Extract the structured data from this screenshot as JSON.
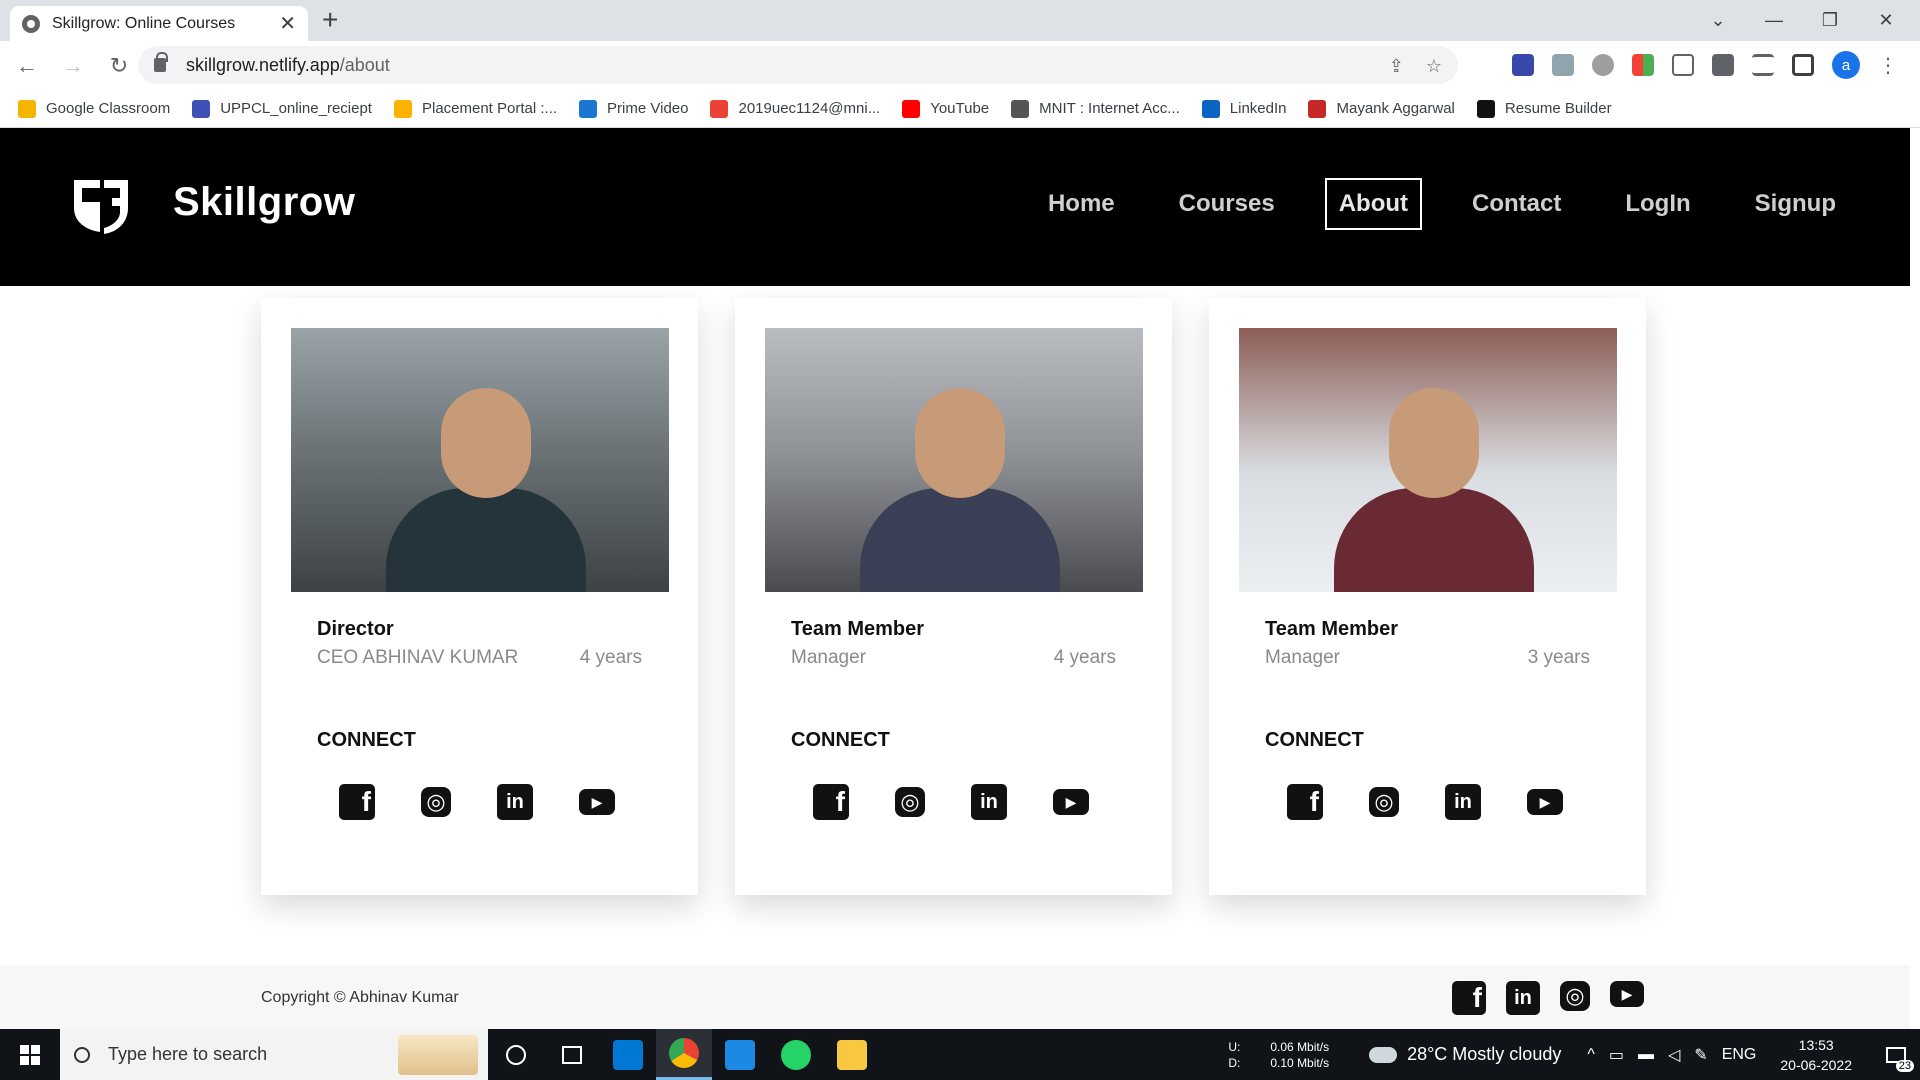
{
  "browser": {
    "tab_title": "Skillgrow: Online Courses",
    "url_host": "skillgrow.netlify.app",
    "url_path": "/about",
    "profile_initial": "a"
  },
  "bookmarks": [
    {
      "label": "Google Classroom",
      "color": "#f4b400"
    },
    {
      "label": "UPPCL_online_reciept",
      "color": "#3f51b5"
    },
    {
      "label": "Placement Portal :...",
      "color": "#ffb300"
    },
    {
      "label": "Prime Video",
      "color": "#1976d2"
    },
    {
      "label": "2019uec1124@mni...",
      "color": "#ea4335"
    },
    {
      "label": "YouTube",
      "color": "#ff0000"
    },
    {
      "label": "MNIT : Internet Acc...",
      "color": "#555555"
    },
    {
      "label": "LinkedIn",
      "color": "#0a66c2"
    },
    {
      "label": "Mayank Aggarwal",
      "color": "#c62828"
    },
    {
      "label": "Resume Builder",
      "color": "#111111"
    }
  ],
  "site": {
    "brand": "Skillgrow",
    "nav": [
      "Home",
      "Courses",
      "About",
      "Contact",
      "LogIn",
      "Signup"
    ],
    "active_nav": "About"
  },
  "cards": [
    {
      "role": "Director",
      "title": "CEO ABHINAV KUMAR",
      "experience": "4 years",
      "connect": "CONNECT"
    },
    {
      "role": "Team Member",
      "title": "Manager",
      "experience": "4 years",
      "connect": "CONNECT"
    },
    {
      "role": "Team Member",
      "title": "Manager",
      "experience": "3 years",
      "connect": "CONNECT"
    }
  ],
  "social_icons": [
    "facebook-icon",
    "instagram-icon",
    "linkedin-icon",
    "youtube-icon"
  ],
  "footer": {
    "copyright": "Copyright © Abhinav Kumar",
    "social_icons": [
      "facebook-icon",
      "linkedin-icon",
      "instagram-icon",
      "youtube-icon"
    ]
  },
  "taskbar": {
    "search_placeholder": "Type here to search",
    "upload_label": "U:",
    "upload_speed": "0.06 Mbit/s",
    "download_label": "D:",
    "download_speed": "0.10 Mbit/s",
    "weather": "28°C  Mostly cloudy",
    "language": "ENG",
    "time": "13:53",
    "date": "20-06-2022",
    "notification_count": "23"
  }
}
